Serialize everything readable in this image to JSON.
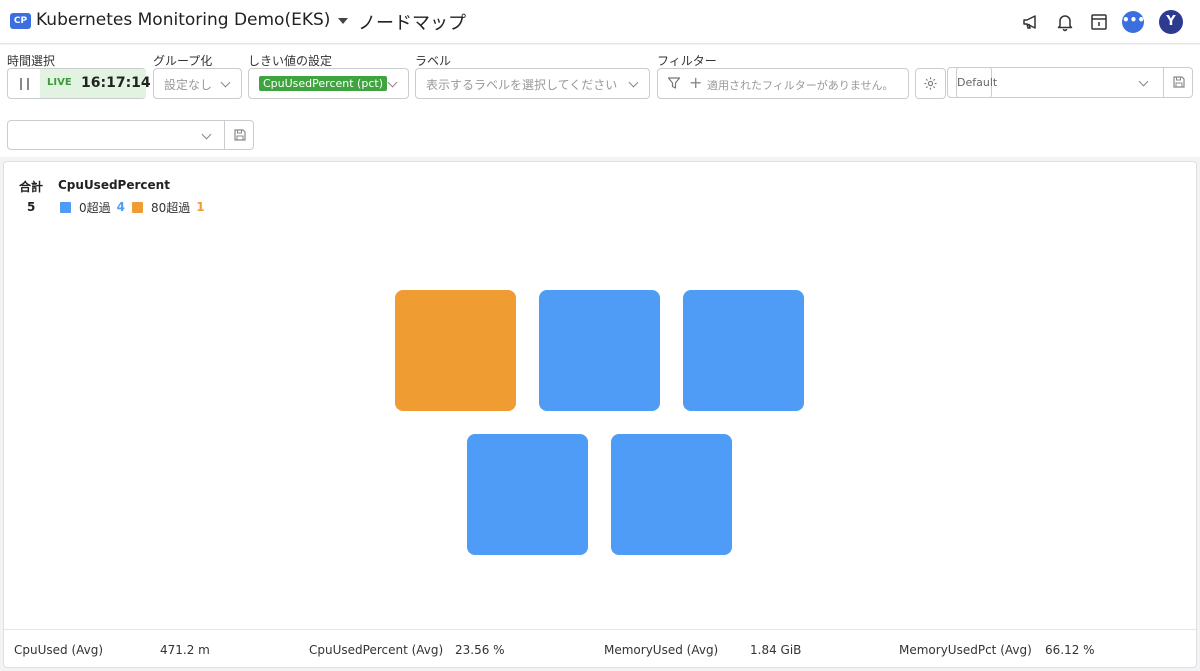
{
  "header": {
    "badge": "CP",
    "project": "Kubernetes Monitoring Demo(EKS)",
    "page_title": "ノードマップ",
    "icons": [
      "megaphone-icon",
      "bell-icon",
      "archive-icon",
      "chat-icon"
    ],
    "chat_glyph": "•••",
    "avatar_initial": "Y"
  },
  "toolbar": {
    "time_label": "時間選択",
    "live_label": "LIVE",
    "live_time": "16:17:14",
    "group_label": "グループ化",
    "group_value": "設定なし",
    "threshold_label": "しきい値の設定",
    "threshold_value": "CpuUsedPercent (pct)",
    "label_label": "ラベル",
    "label_placeholder": "表示するラベルを選択してください",
    "filter_label": "フィルター",
    "filter_placeholder": "適用されたフィルターがありません。",
    "preset_value": "Default",
    "row2_value": ""
  },
  "summary": {
    "total_label": "合計",
    "total_value": "5",
    "metric": "CpuUsedPercent",
    "legend": [
      {
        "label": "0超過",
        "count": "4",
        "color": "#4f9cf7"
      },
      {
        "label": "80超過",
        "count": "1",
        "color": "#ef9c32"
      }
    ]
  },
  "nodes": [
    {
      "level": "80超過",
      "color": "#ef9c32"
    },
    {
      "level": "0超過",
      "color": "#4f9cf7"
    },
    {
      "level": "0超過",
      "color": "#4f9cf7"
    },
    {
      "level": "0超過",
      "color": "#4f9cf7"
    },
    {
      "level": "0超過",
      "color": "#4f9cf7"
    }
  ],
  "stats": [
    {
      "label": "CpuUsed (Avg)",
      "value": "471.2 m"
    },
    {
      "label": "CpuUsedPercent (Avg)",
      "value": "23.56 %"
    },
    {
      "label": "MemoryUsed (Avg)",
      "value": "1.84 GiB"
    },
    {
      "label": "MemoryUsedPct (Avg)",
      "value": "66.12 %"
    }
  ]
}
